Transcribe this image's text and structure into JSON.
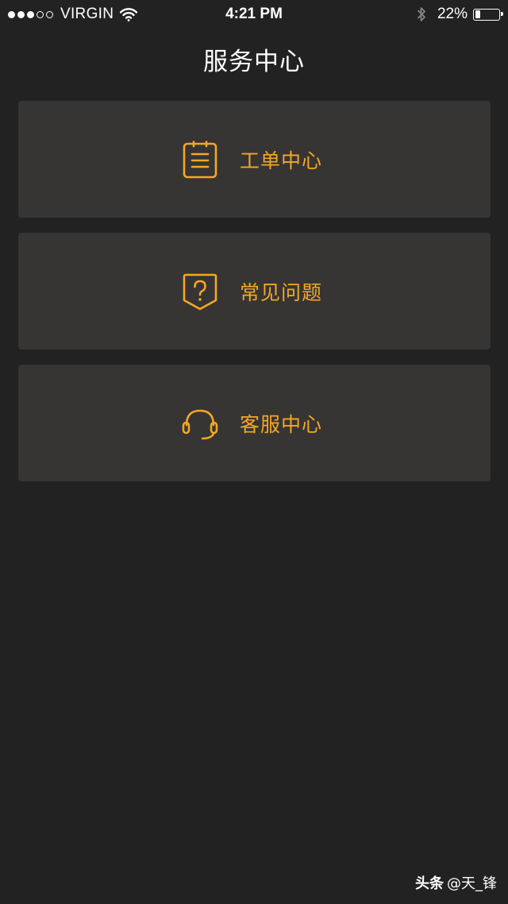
{
  "status_bar": {
    "signal_full": 3,
    "signal_total": 5,
    "carrier": "VIRGIN",
    "time": "4:21 PM",
    "battery_percent": "22%",
    "battery_level": 0.22,
    "icons": [
      "wifi-icon",
      "bluetooth-icon",
      "battery-icon"
    ]
  },
  "page": {
    "title": "服务中心"
  },
  "menu": {
    "items": [
      {
        "label": "工单中心",
        "icon": "clipboard-list-icon"
      },
      {
        "label": "常见问题",
        "icon": "question-badge-icon"
      },
      {
        "label": "客服中心",
        "icon": "headset-icon"
      }
    ]
  },
  "watermark": {
    "brand": "头条",
    "handle": "@天_锋"
  },
  "colors": {
    "background": "#222222",
    "card": "#363534",
    "accent": "#F5A623",
    "text": "#FFFFFF"
  }
}
